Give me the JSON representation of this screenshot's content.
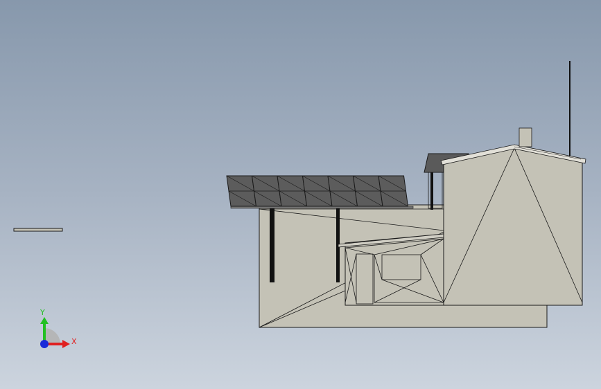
{
  "app": {
    "view": "cad-model-viewport"
  },
  "triad": {
    "x_label": "X",
    "y_label": "Y",
    "colors": {
      "x": "#e02020",
      "y": "#22c022",
      "z": "#1a2bd8"
    }
  },
  "model": {
    "wall_color": "#c4c2b6",
    "panel_color": "#5c5c5c",
    "line_color": "#1a1a1a",
    "solar_panel_count": 7
  }
}
